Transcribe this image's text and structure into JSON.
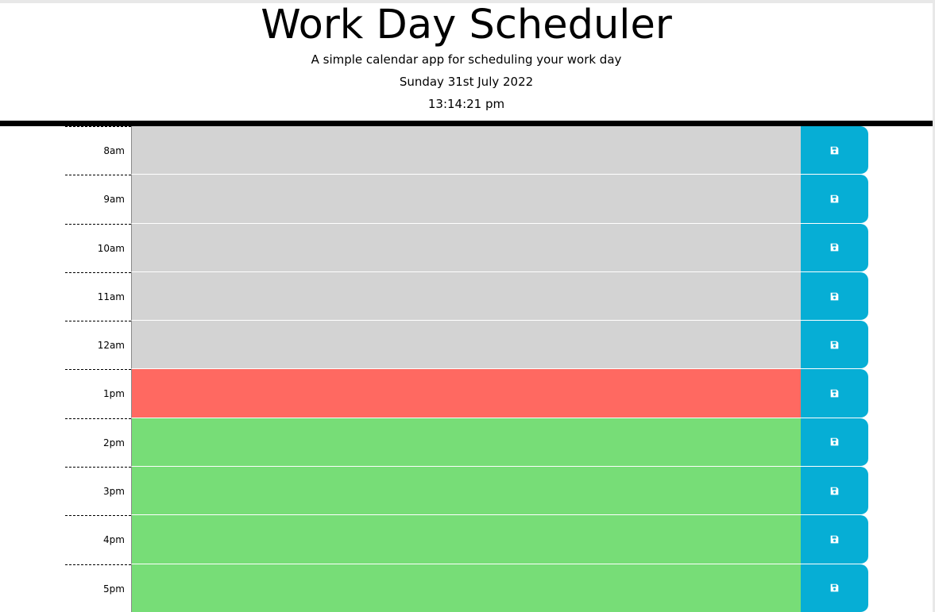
{
  "header": {
    "title": "Work Day Scheduler",
    "subtitle": "A simple calendar app for scheduling your work day",
    "date": "Sunday 31st July 2022",
    "time": "13:14:21 pm"
  },
  "colors": {
    "past": "#d3d3d3",
    "present": "#ff6961",
    "future": "#77dd77",
    "save_button": "#06aed5"
  },
  "save_icon": "floppy-disk-icon",
  "time_blocks": [
    {
      "hour": "8am",
      "state": "past",
      "text": ""
    },
    {
      "hour": "9am",
      "state": "past",
      "text": ""
    },
    {
      "hour": "10am",
      "state": "past",
      "text": ""
    },
    {
      "hour": "11am",
      "state": "past",
      "text": ""
    },
    {
      "hour": "12am",
      "state": "past",
      "text": ""
    },
    {
      "hour": "1pm",
      "state": "present",
      "text": ""
    },
    {
      "hour": "2pm",
      "state": "future",
      "text": ""
    },
    {
      "hour": "3pm",
      "state": "future",
      "text": ""
    },
    {
      "hour": "4pm",
      "state": "future",
      "text": ""
    },
    {
      "hour": "5pm",
      "state": "future",
      "text": ""
    }
  ]
}
